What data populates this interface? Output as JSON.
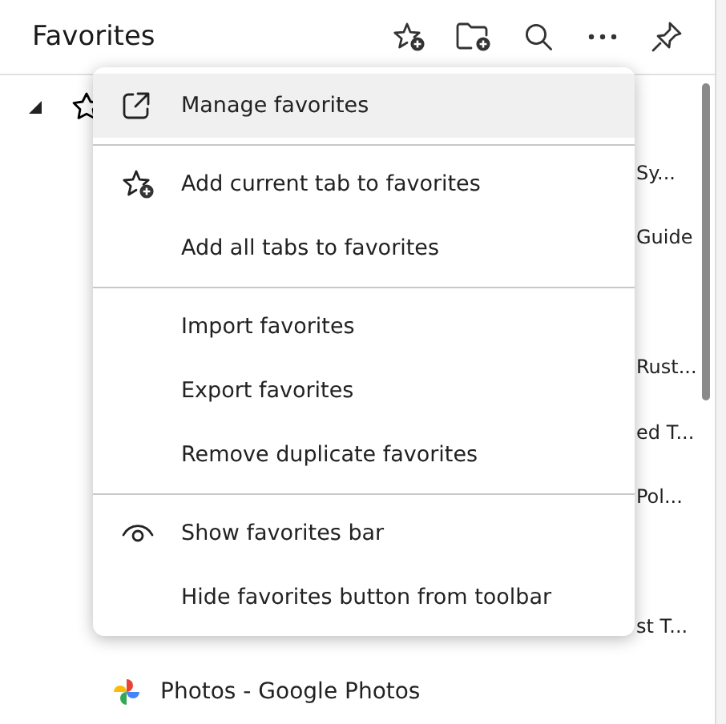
{
  "panel": {
    "title": "Favorites"
  },
  "tree": [
    {
      "kind": "folder",
      "expanded": true
    },
    {
      "kind": "clipped",
      "label": "Sy..."
    },
    {
      "kind": "clipped",
      "label": "Guide"
    },
    {
      "kind": "clipped"
    },
    {
      "kind": "clipped",
      "label": "Rust..."
    },
    {
      "kind": "clipped",
      "label": "ed T..."
    },
    {
      "kind": "clipped",
      "label": "Pol..."
    },
    {
      "kind": "clipped"
    },
    {
      "kind": "clipped",
      "label": "st T..."
    },
    {
      "kind": "site",
      "label": "Photos - Google Photos"
    }
  ],
  "menu": {
    "sections": [
      [
        {
          "kind": "link",
          "label": "Manage favorites",
          "selected": true
        }
      ],
      [
        {
          "kind": "add",
          "label": "Add current tab to favorites",
          "selected": false
        },
        {
          "kind": "plain",
          "label": "Add all tabs to favorites",
          "selected": false
        }
      ],
      [
        {
          "kind": "plain",
          "label": "Import favorites",
          "selected": false
        },
        {
          "kind": "plain",
          "label": "Export favorites",
          "selected": false
        },
        {
          "kind": "plain",
          "label": "Remove duplicate favorites",
          "selected": false
        }
      ],
      [
        {
          "kind": "toggle",
          "label": "Show favorites bar",
          "selected": false
        },
        {
          "kind": "plain",
          "label": "Hide favorites button from toolbar",
          "selected": false
        }
      ]
    ]
  }
}
